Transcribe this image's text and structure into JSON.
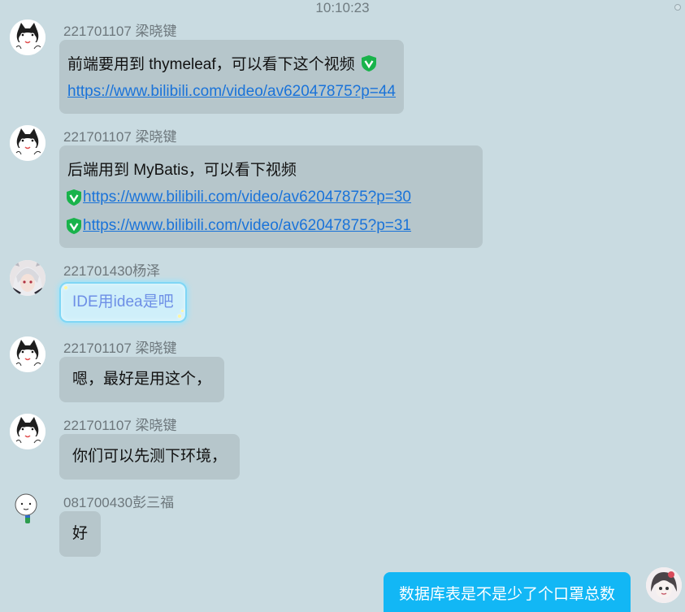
{
  "timestamp": "10:10:23",
  "messages": [
    {
      "sender": "221701107 梁晓键",
      "lines": [
        {
          "text": "前端要用到 thymeleaf，可以看下这个视频",
          "shield_after": true
        },
        {
          "link": "https://www.bilibili.com/video/av62047875?p=44"
        }
      ]
    },
    {
      "sender": "221701107 梁晓键",
      "lines": [
        {
          "text": "后端用到 MyBatis，可以看下视频"
        },
        {
          "link": "https://www.bilibili.com/video/av62047875?p=30",
          "shield_before": true
        },
        {
          "link": "https://www.bilibili.com/video/av62047875?p=31",
          "shield_before": true
        }
      ]
    },
    {
      "sender": "221701430杨泽",
      "lines": [
        {
          "text": "IDE用idea是吧"
        }
      ]
    },
    {
      "sender": "221701107 梁晓键",
      "lines": [
        {
          "text": "嗯，最好是用这个，"
        }
      ]
    },
    {
      "sender": "221701107 梁晓键",
      "lines": [
        {
          "text": "你们可以先测下环境，"
        }
      ]
    },
    {
      "sender": "081700430彭三福",
      "lines": [
        {
          "text": "好"
        }
      ]
    }
  ],
  "self_message": {
    "text": "数据库表是不是少了个口罩总数"
  },
  "colors": {
    "background": "#c9dbe1",
    "bubble": "#b6c6cb",
    "self_bubble": "#12b7f5",
    "link": "#1a73d9",
    "shield": "#19b34b"
  }
}
